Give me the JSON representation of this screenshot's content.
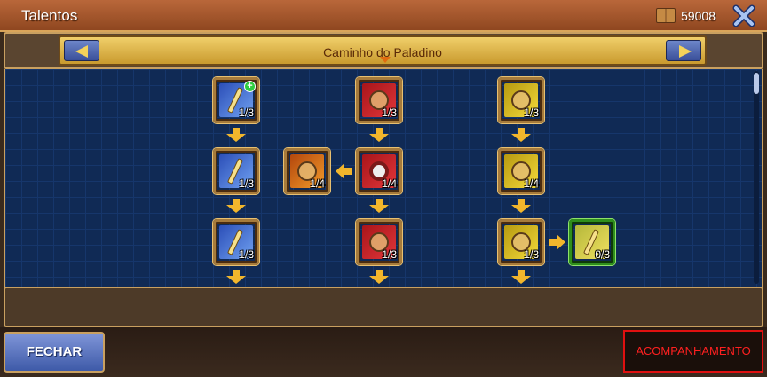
{
  "window": {
    "title": "Talentos",
    "points": "59008"
  },
  "nav": {
    "path_name": "Caminho do Paladino"
  },
  "talents": {
    "col1_row1": "1/3",
    "col1_row2": "1/3",
    "col1_row3": "1/3",
    "col2_row2": "1/4",
    "col3_row1": "1/3",
    "col3_row2": "1/4",
    "col3_row3": "1/3",
    "col4_row1": "1/3",
    "col4_row2": "1/4",
    "col4_row3": "1/3",
    "col5_row3": "0/3"
  },
  "footer": {
    "close_label": "FECHAR",
    "follow_label": "ACOMPANHAMENTO"
  },
  "icons": {
    "points": "book-icon",
    "close": "close-icon",
    "prev": "arrow-left-icon",
    "next": "arrow-right-icon"
  },
  "colors": {
    "title_bar": "#9c5028",
    "tree_bg": "#102a55",
    "accent_gold": "#f2b62c",
    "follow_border": "#e01010"
  }
}
